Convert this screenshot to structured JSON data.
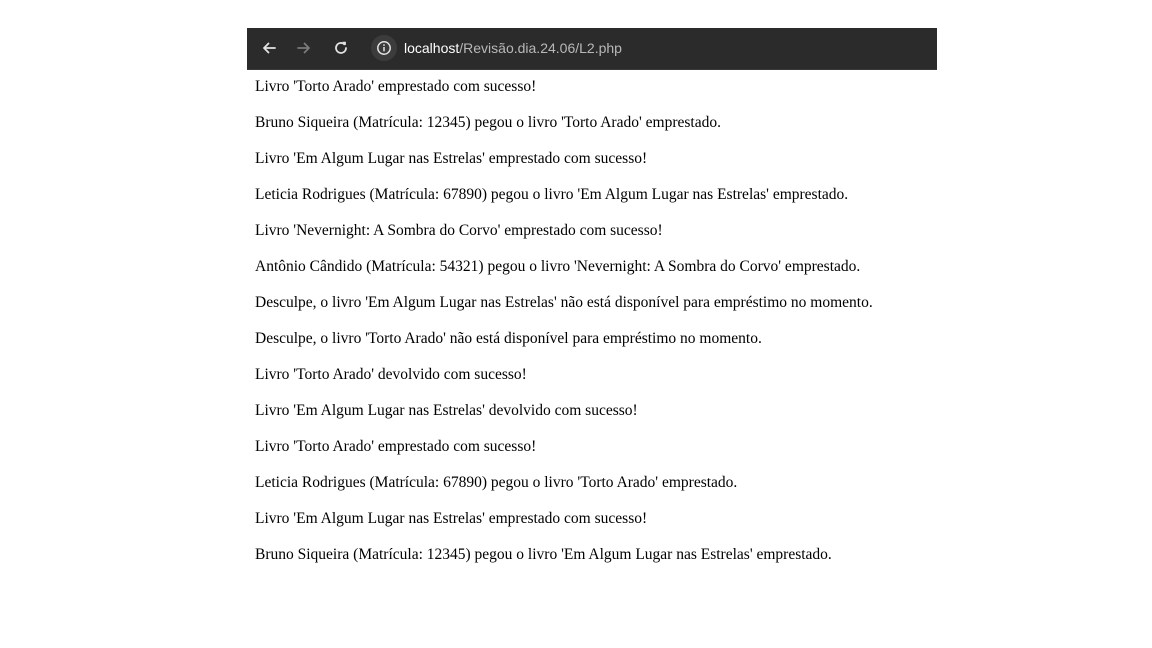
{
  "browser": {
    "url_host": "localhost",
    "url_path": "/Revisão.dia.24.06/L2.php",
    "icons": {
      "back": "arrow-left-icon",
      "forward": "arrow-right-icon",
      "reload": "reload-icon",
      "site_info": "info-icon"
    },
    "colors": {
      "toolbar_bg": "#2b2b2b",
      "page_bg": "#ffffff",
      "text": "#000000"
    }
  },
  "page": {
    "lines": [
      "Livro 'Torto Arado' emprestado com sucesso!",
      "Bruno Siqueira (Matrícula: 12345) pegou o livro 'Torto Arado' emprestado.",
      "Livro 'Em Algum Lugar nas Estrelas' emprestado com sucesso!",
      "Leticia Rodrigues (Matrícula: 67890) pegou o livro 'Em Algum Lugar nas Estrelas' emprestado.",
      "Livro 'Nevernight: A Sombra do Corvo' emprestado com sucesso!",
      "Antônio Cândido (Matrícula: 54321) pegou o livro 'Nevernight: A Sombra do Corvo' emprestado.",
      "Desculpe, o livro 'Em Algum Lugar nas Estrelas' não está disponível para empréstimo no momento.",
      "Desculpe, o livro 'Torto Arado' não está disponível para empréstimo no momento.",
      "Livro 'Torto Arado' devolvido com sucesso!",
      "Livro 'Em Algum Lugar nas Estrelas' devolvido com sucesso!",
      "Livro 'Torto Arado' emprestado com sucesso!",
      "Leticia Rodrigues (Matrícula: 67890) pegou o livro 'Torto Arado' emprestado.",
      "Livro 'Em Algum Lugar nas Estrelas' emprestado com sucesso!",
      "Bruno Siqueira (Matrícula: 12345) pegou o livro 'Em Algum Lugar nas Estrelas' emprestado."
    ]
  }
}
